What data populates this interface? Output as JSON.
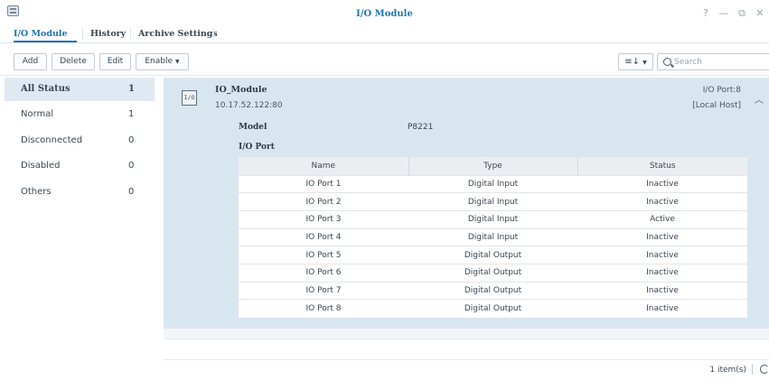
{
  "window": {
    "title": "I/O Module",
    "controls": {
      "help": "?",
      "minimize": "—",
      "maximize": "⧉",
      "close": "✕"
    }
  },
  "tabs": [
    {
      "label": "I/O Module",
      "active": true
    },
    {
      "label": "History",
      "active": false
    },
    {
      "label": "Archive Settings",
      "active": false
    }
  ],
  "toolbar": {
    "add_label": "Add",
    "delete_label": "Delete",
    "edit_label": "Edit",
    "enable_label": "Enable",
    "sort_label": "≡↓",
    "search_placeholder": "Search"
  },
  "sidebar": {
    "items": [
      {
        "label": "All Status",
        "count": "1",
        "active": true
      },
      {
        "label": "Normal",
        "count": "1",
        "active": false
      },
      {
        "label": "Disconnected",
        "count": "0",
        "active": false
      },
      {
        "label": "Disabled",
        "count": "0",
        "active": false
      },
      {
        "label": "Others",
        "count": "0",
        "active": false
      }
    ]
  },
  "device": {
    "icon_text": "I/O",
    "name": "IO_Module",
    "ip": "10.17.52.122:80",
    "port_info": "I/O Port:8",
    "host": "[Local Host]",
    "model_label": "Model",
    "model_value": "P8221",
    "ioport_label": "I/O Port",
    "table": {
      "headers": [
        "Name",
        "Type",
        "Status"
      ],
      "rows": [
        {
          "name": "IO Port 1",
          "type": "Digital Input",
          "status": "Inactive"
        },
        {
          "name": "IO Port 2",
          "type": "Digital Input",
          "status": "Inactive"
        },
        {
          "name": "IO Port 3",
          "type": "Digital Input",
          "status": "Active"
        },
        {
          "name": "IO Port 4",
          "type": "Digital Input",
          "status": "Inactive"
        },
        {
          "name": "IO Port 5",
          "type": "Digital Output",
          "status": "Inactive"
        },
        {
          "name": "IO Port 6",
          "type": "Digital Output",
          "status": "Inactive"
        },
        {
          "name": "IO Port 7",
          "type": "Digital Output",
          "status": "Inactive"
        },
        {
          "name": "IO Port 8",
          "type": "Digital Output",
          "status": "Inactive"
        }
      ]
    }
  },
  "footer": {
    "item_count": "1 item(s)"
  },
  "colors": {
    "accent": "#1e73b5",
    "card_bg": "#d8e6ef",
    "status_inactive": "#2ea43a",
    "status_active": "#2678c0"
  }
}
